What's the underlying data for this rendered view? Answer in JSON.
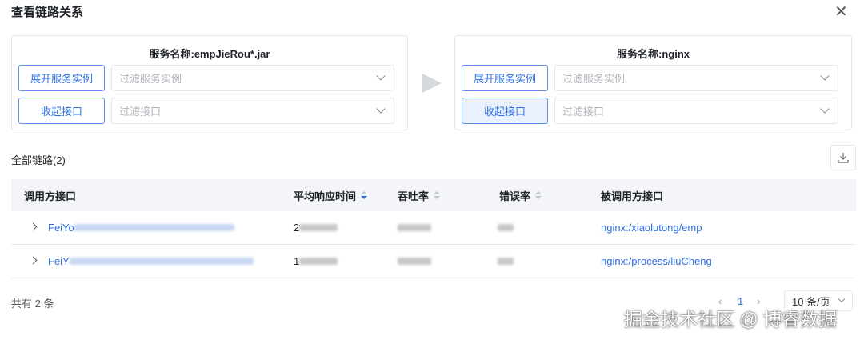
{
  "dialog": {
    "title": "查看链路关系",
    "close_icon": "close-icon"
  },
  "left": {
    "service_name": "服务名称:empJieRou*.jar",
    "expand_btn": "展开服务实例",
    "filter_instance_ph": "过滤服务实例",
    "collapse_btn": "收起接口",
    "filter_api_ph": "过滤接口"
  },
  "right": {
    "service_name": "服务名称:nginx",
    "expand_btn": "展开服务实例",
    "filter_instance_ph": "过滤服务实例",
    "collapse_btn": "收起接口",
    "filter_api_ph": "过滤接口"
  },
  "links": {
    "label": "全部链路(2)"
  },
  "table": {
    "headers": [
      "调用方接口",
      "平均响应时间",
      "吞吐率",
      "错误率",
      "被调用方接口"
    ],
    "rows": [
      {
        "caller": "FeiYo",
        "avg": "2",
        "callee": "nginx:/xiaolutong/emp"
      },
      {
        "caller": "FeiY",
        "avg": "1",
        "callee": "nginx:/process/liuCheng"
      }
    ]
  },
  "footer": {
    "total": "共有 2 条",
    "page": "1",
    "page_size": "10 条/页"
  },
  "watermark": "掘金技术社区 @ 博睿数据",
  "colors": {
    "accent": "#2f6fe0"
  }
}
